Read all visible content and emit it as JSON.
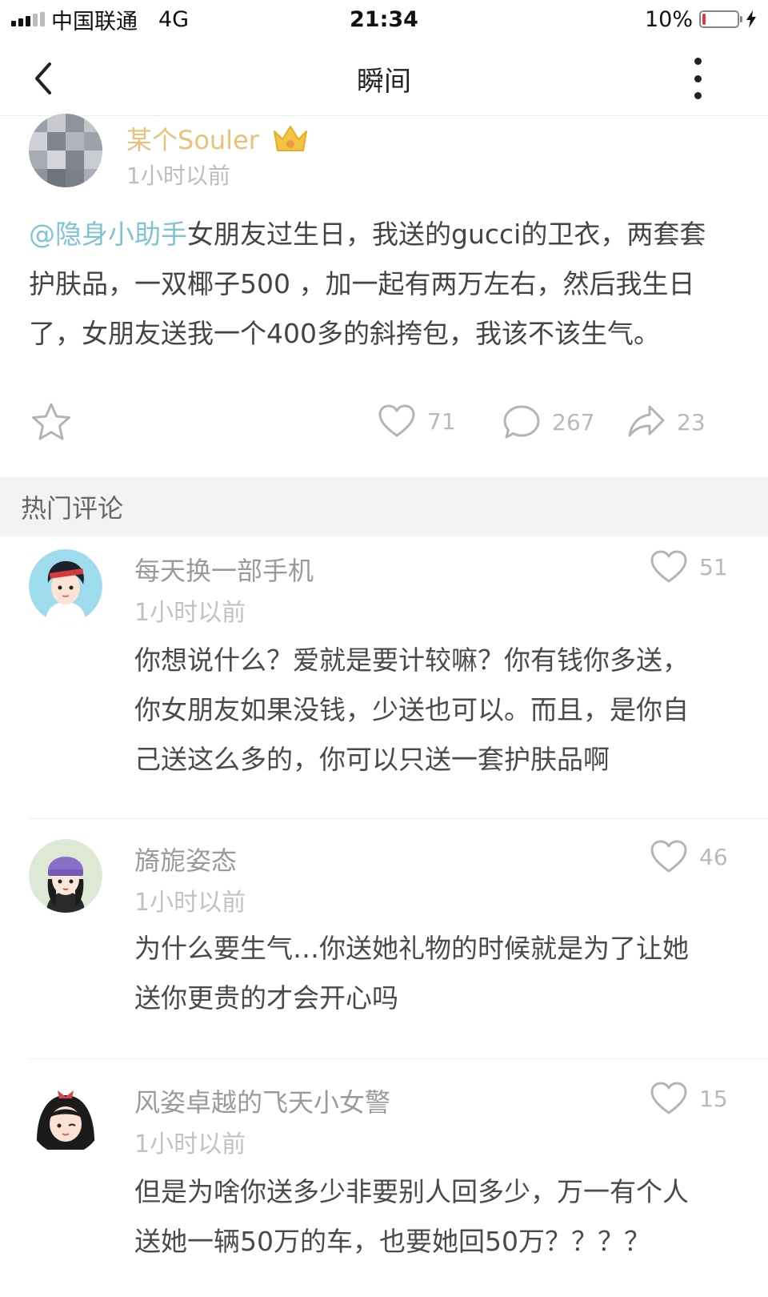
{
  "status_bar": {
    "carrier": "中国联通",
    "network": "4G",
    "time": "21:34",
    "battery_percent": "10%",
    "battery_level": 0.1
  },
  "nav": {
    "title": "瞬间",
    "back_icon": "chevron-left-icon",
    "more_icon": "more-vertical-icon"
  },
  "post": {
    "author": "某个Souler",
    "badge_icon": "crown-icon",
    "time": "1小时以前",
    "mention": "@隐身小助手",
    "body_lines": [
      "女朋友过生日，我送的gucci的卫衣，两套套",
      "护肤品，一双椰子500 ，加一起有两万左右，然后我生日",
      "了，女朋友送我一个400多的斜挎包，我该不该生气。"
    ],
    "likes": "71",
    "comments": "267",
    "shares": "23"
  },
  "comments_section": {
    "title": "热门评论",
    "items": [
      {
        "name": "每天换一部手机",
        "time": "1小时以前",
        "likes": "51",
        "lines": [
          "你想说什么？爱就是要计较嘛？你有钱你多送，",
          "你女朋友如果没钱，少送也可以。而且，是你自",
          "己送这么多的，你可以只送一套护肤品啊"
        ]
      },
      {
        "name": "旖旎姿态",
        "time": "1小时以前",
        "likes": "46",
        "lines": [
          "为什么要生气…你送她礼物的时候就是为了让她",
          "送你更贵的才会开心吗"
        ]
      },
      {
        "name": "风姿卓越的飞天小女警",
        "time": "1小时以前",
        "likes": "15",
        "lines": [
          "但是为啥你送多少非要别人回多少，万一有个人",
          "送她一辆50万的车，也要她回50万？？？？"
        ]
      }
    ]
  },
  "colors": {
    "author": "#e7c27a",
    "mention": "#7fc3d4",
    "muted": "#b9b9b9",
    "section_bg": "#f3f3f3",
    "battery_low": "#e03b3b"
  }
}
